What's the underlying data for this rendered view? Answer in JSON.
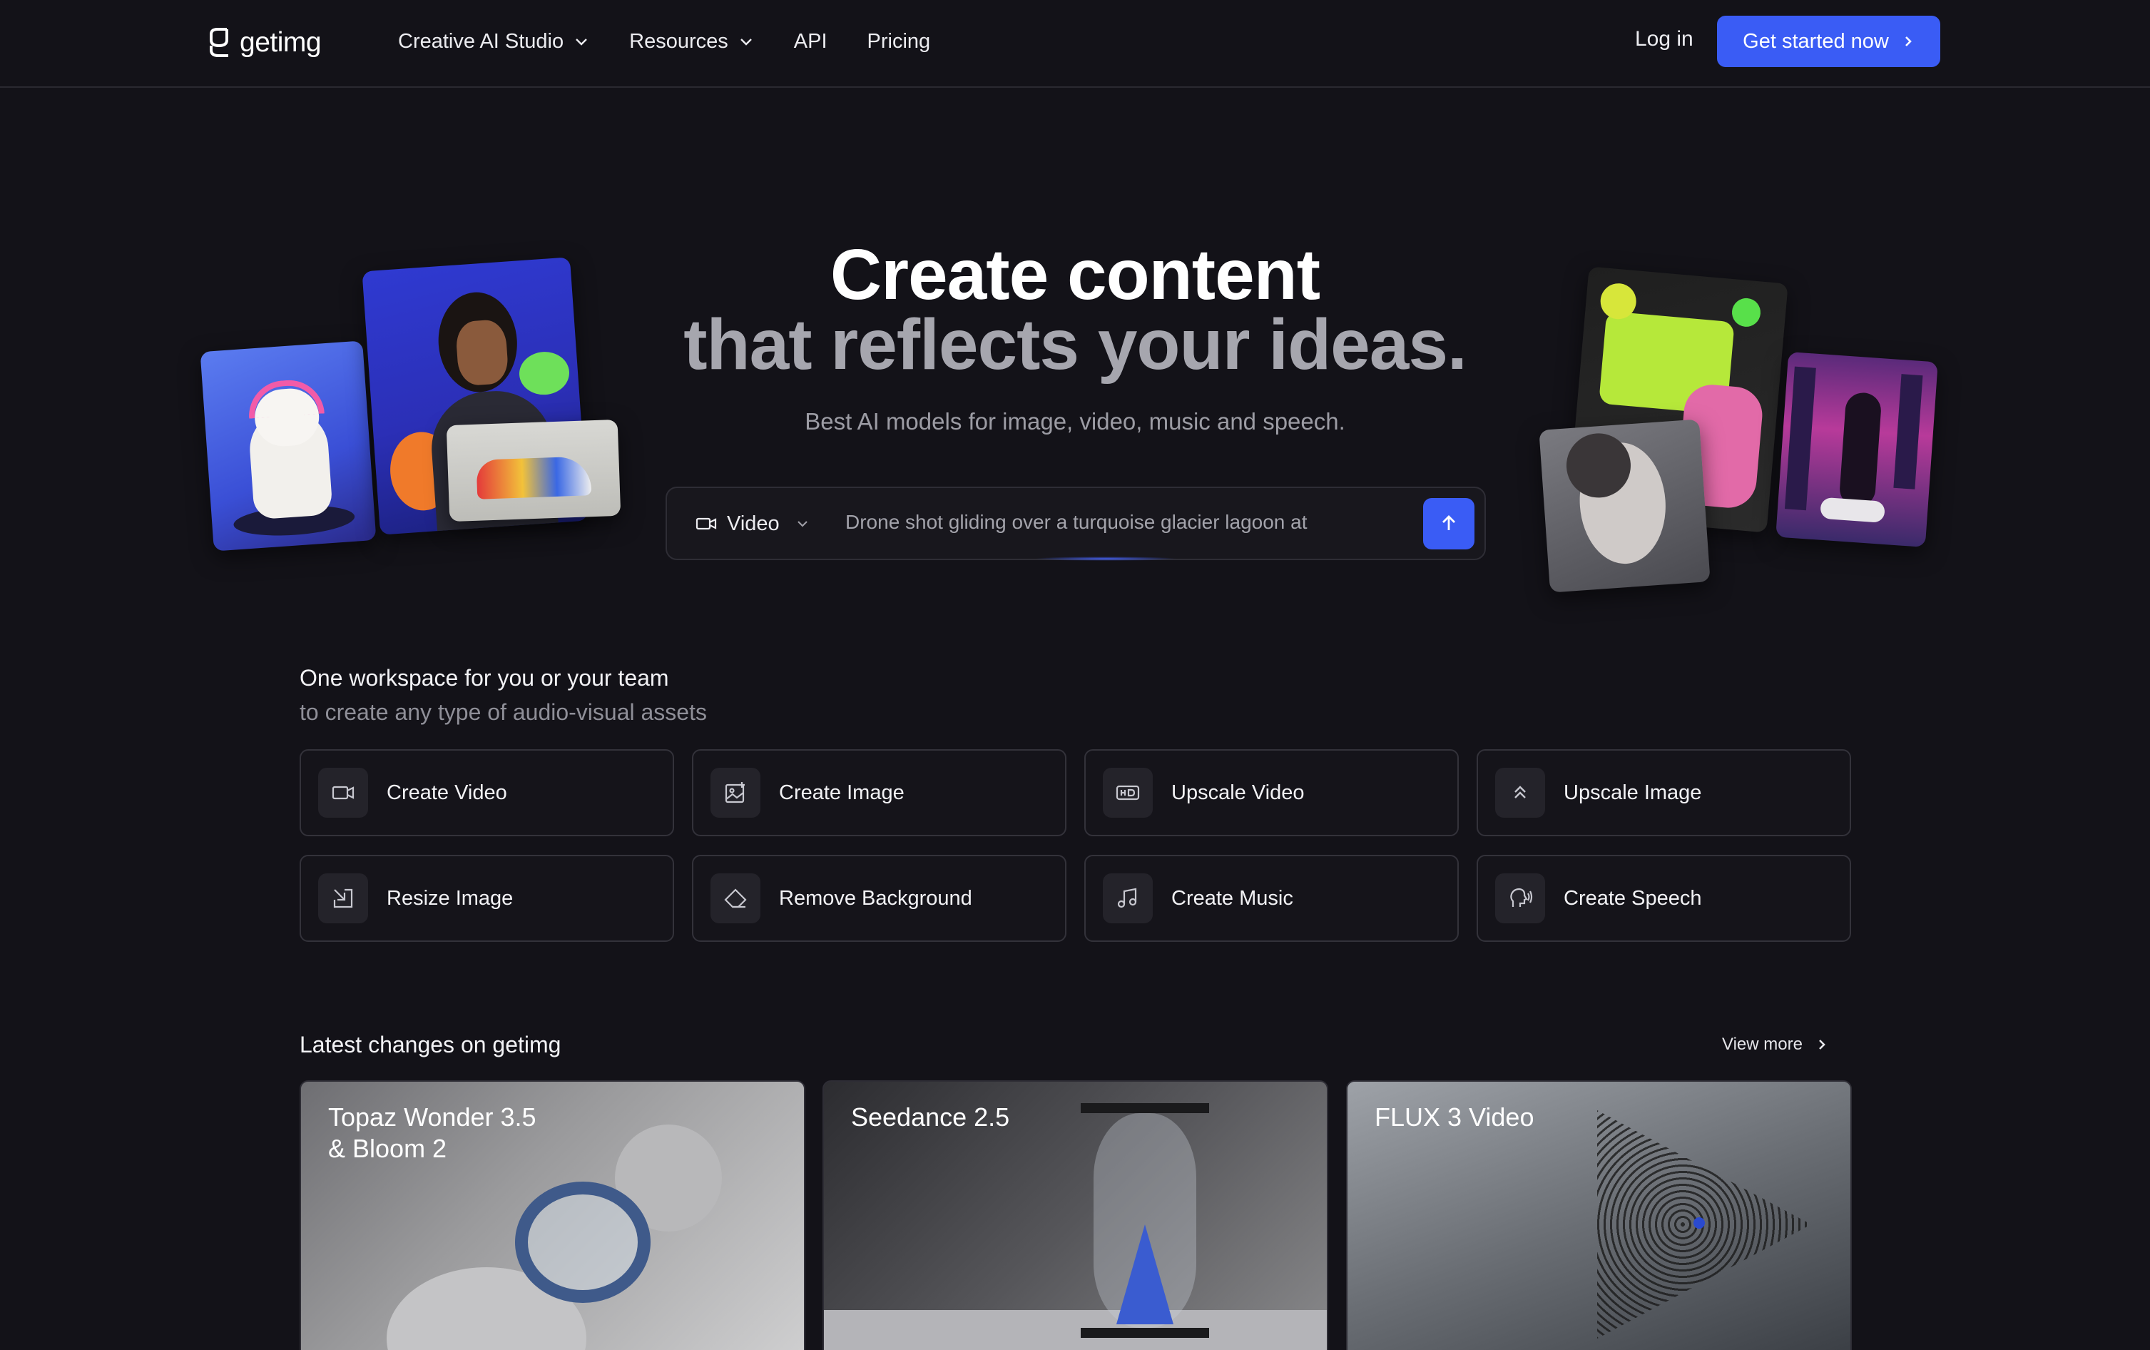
{
  "header": {
    "logo_text": "getimg",
    "nav": [
      {
        "label": "Creative AI Studio",
        "has_dropdown": true
      },
      {
        "label": "Resources",
        "has_dropdown": true
      },
      {
        "label": "API",
        "has_dropdown": false
      },
      {
        "label": "Pricing",
        "has_dropdown": false
      }
    ],
    "login_label": "Log in",
    "cta_label": "Get started now"
  },
  "hero": {
    "title_line1": "Create content",
    "title_line2": "that reflects your ideas.",
    "subtitle": "Best AI models for image, video, music and speech.",
    "prompt": {
      "mode_label": "Video",
      "text": "Drone shot gliding over a turquoise glacier lagoon at"
    }
  },
  "workspace": {
    "title": "One workspace for you or your team",
    "subtitle": "to create any type of audio-visual assets",
    "tools": [
      {
        "label": "Create Video",
        "icon": "video-camera-icon"
      },
      {
        "label": "Create Image",
        "icon": "image-plus-icon"
      },
      {
        "label": "Upscale Video",
        "icon": "hd-icon"
      },
      {
        "label": "Upscale Image",
        "icon": "double-chevron-up-icon"
      },
      {
        "label": "Resize Image",
        "icon": "resize-arrow-icon"
      },
      {
        "label": "Remove Background",
        "icon": "eraser-icon"
      },
      {
        "label": "Create Music",
        "icon": "music-note-icon"
      },
      {
        "label": "Create Speech",
        "icon": "speech-head-icon"
      }
    ]
  },
  "latest": {
    "title": "Latest changes on getimg",
    "view_more": "View more",
    "cards": [
      {
        "title_line1": "Topaz Wonder 3.5",
        "title_line2": "& Bloom 2"
      },
      {
        "title_line1": "Seedance 2.5",
        "title_line2": ""
      },
      {
        "title_line1": "FLUX 3 Video",
        "title_line2": ""
      }
    ]
  },
  "colors": {
    "background": "#131218",
    "accent": "#3a5cf5",
    "card_border": "#33323a",
    "muted_text": "#9c9ca4"
  }
}
